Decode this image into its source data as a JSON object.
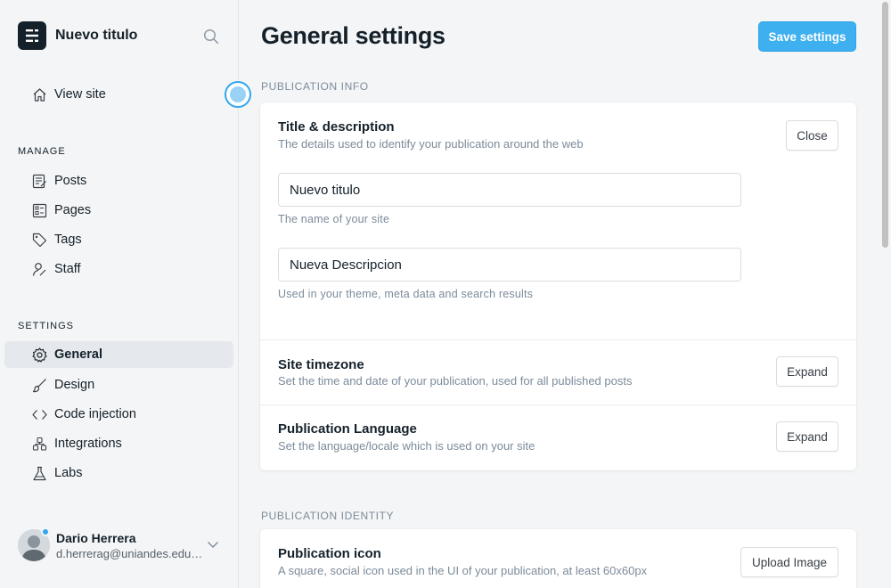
{
  "app": {
    "site_title": "Nuevo titulo"
  },
  "sidebar": {
    "view_site": "View site",
    "manage_label": "MANAGE",
    "manage_items": [
      "Posts",
      "Pages",
      "Tags",
      "Staff"
    ],
    "settings_label": "SETTINGS",
    "settings_items": [
      "General",
      "Design",
      "Code injection",
      "Integrations",
      "Labs"
    ],
    "active_item": "General"
  },
  "user": {
    "name": "Dario Herrera",
    "email": "d.herrerag@uniandes.edu.co",
    "status_color": "#30a6ee"
  },
  "header": {
    "title": "General settings",
    "save_label": "Save settings"
  },
  "publication_info": {
    "label": "PUBLICATION INFO",
    "title_desc": {
      "title": "Title & description",
      "desc": "The details used to identify your publication around the web",
      "button": "Close",
      "title_field_value": "Nuevo titulo",
      "title_hint": "The name of your site",
      "desc_field_value": "Nueva Descripcion",
      "desc_hint": "Used in your theme, meta data and search results"
    },
    "timezone": {
      "title": "Site timezone",
      "desc": "Set the time and date of your publication, used for all published posts",
      "button": "Expand"
    },
    "language": {
      "title": "Publication Language",
      "desc": "Set the language/locale which is used on your site",
      "button": "Expand"
    }
  },
  "publication_identity": {
    "label": "PUBLICATION IDENTITY",
    "icon": {
      "title": "Publication icon",
      "desc": "A square, social icon used in the UI of your publication, at least 60x60px",
      "button": "Upload Image"
    }
  },
  "colors": {
    "accent": "#3eb0ef",
    "sidebar_bg": "#f4f5f6",
    "text": "#15212a",
    "muted": "#7c8b9a"
  }
}
